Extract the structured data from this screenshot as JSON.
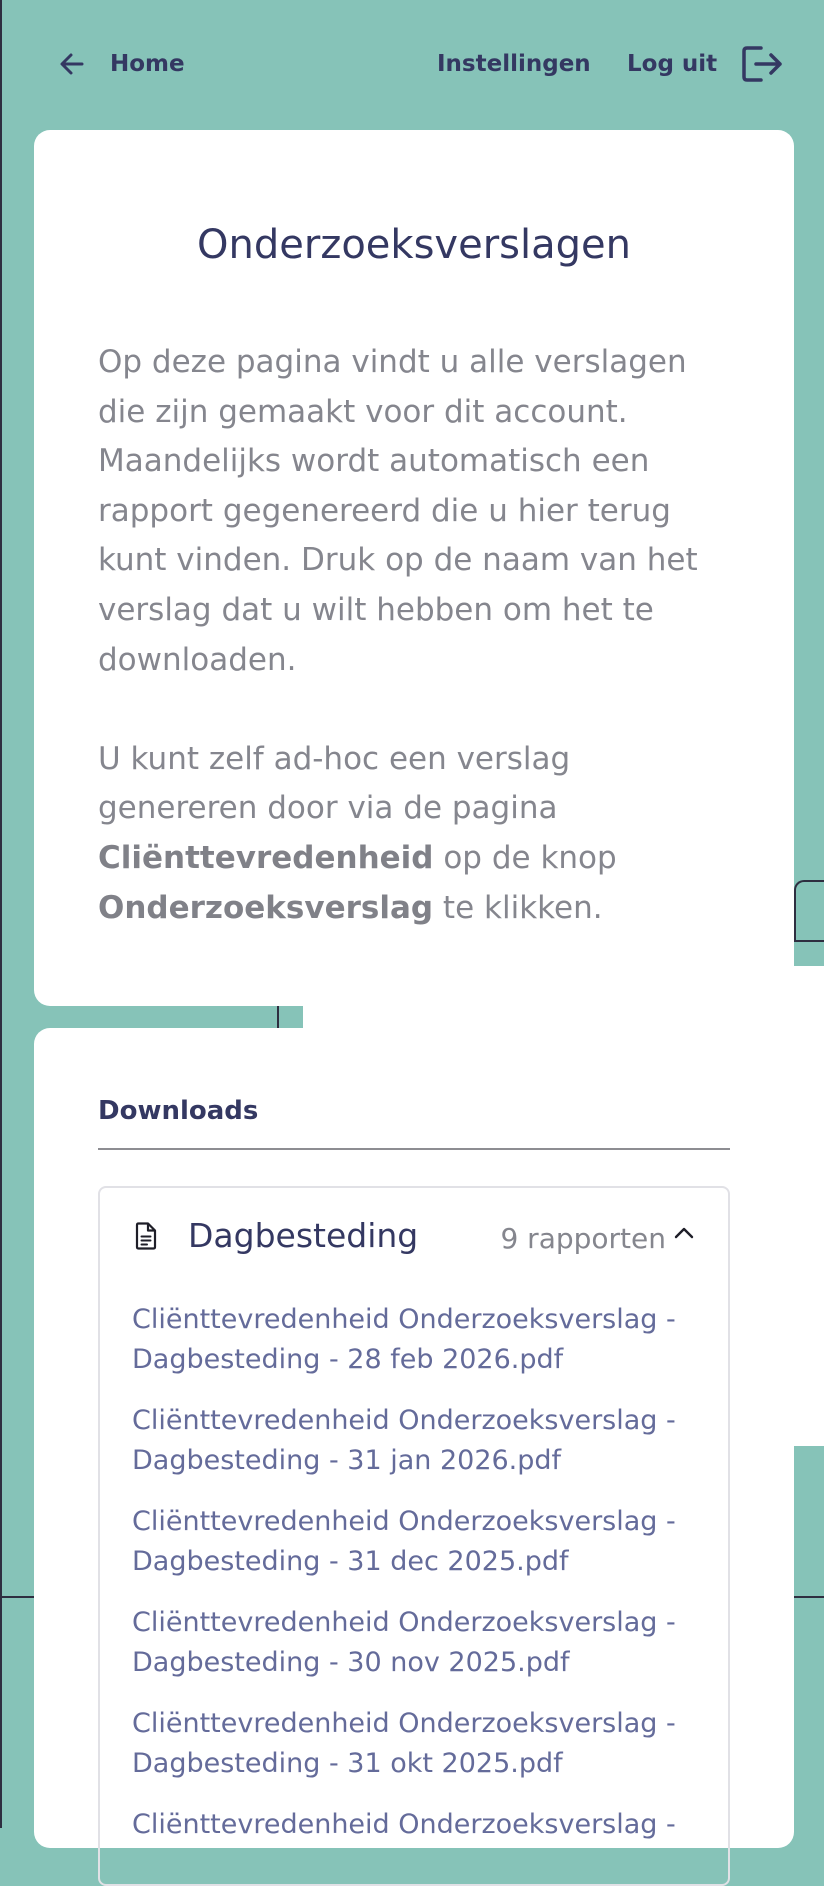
{
  "nav": {
    "home_label": "Home",
    "settings_label": "Instellingen",
    "logout_label": "Log uit"
  },
  "intro": {
    "title": "Onderzoeksverslagen",
    "paragraph1": "Op deze pagina vindt u alle verslagen die zijn gemaakt voor dit account. Maandelijks wordt automatisch een rapport gegenereerd die u hier terug kunt vinden. Druk op de naam van het verslag dat u wilt hebben om het te downloaden.",
    "paragraph2_part1": "U kunt zelf ad-hoc een verslag genereren door via de pagina ",
    "paragraph2_bold1": "Cliënttevredenheid",
    "paragraph2_part2": " op de knop ",
    "paragraph2_bold2": "Onderzoeksverslag",
    "paragraph2_part3": " te klikken."
  },
  "downloads": {
    "heading": "Downloads",
    "group": {
      "title": "Dagbesteding",
      "count": "9 rapporten",
      "files": [
        "Cliënttevredenheid Onderzoeksverslag - Dagbesteding - 28 feb 2026.pdf",
        "Cliënttevredenheid Onderzoeksverslag - Dagbesteding - 31 jan 2026.pdf",
        "Cliënttevredenheid Onderzoeksverslag - Dagbesteding - 31 dec 2025.pdf",
        "Cliënttevredenheid Onderzoeksverslag - Dagbesteding - 30 nov 2025.pdf",
        "Cliënttevredenheid Onderzoeksverslag - Dagbesteding - 31 okt 2025.pdf",
        "Cliënttevredenheid Onderzoeksverslag -"
      ]
    }
  },
  "colors": {
    "background": "#86c3b8",
    "primary_text": "#343862",
    "muted_text": "#85868e",
    "link": "#646b9a",
    "card": "#ffffff"
  },
  "icons": {
    "home": "arrow-left-icon",
    "logout": "logout-icon",
    "document": "document-icon",
    "chevron": "chevron-up-icon"
  }
}
